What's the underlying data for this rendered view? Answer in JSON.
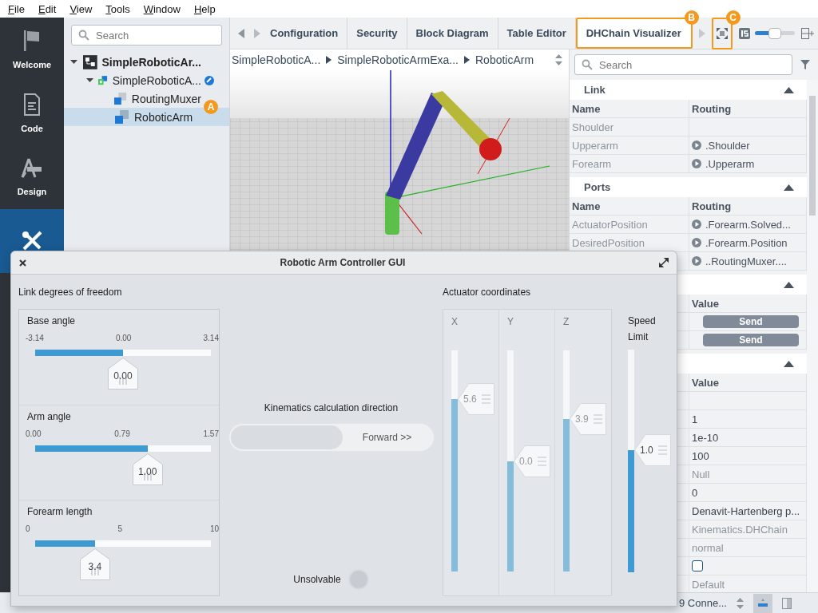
{
  "menu": [
    "File",
    "Edit",
    "View",
    "Tools",
    "Window",
    "Help"
  ],
  "activity_bar": [
    {
      "label": "Welcome",
      "selected": false
    },
    {
      "label": "Code",
      "selected": false
    },
    {
      "label": "Design",
      "selected": false
    },
    {
      "selected": true
    }
  ],
  "tree": {
    "search": {
      "placeholder": "Search"
    },
    "callout": "A",
    "items": [
      {
        "label": "SimpleRoboticAr...",
        "kind": "project",
        "expanded": true,
        "selected": false,
        "children": [
          {
            "label": "SimpleRoboticA...",
            "kind": "module",
            "expanded": true,
            "selected": false,
            "children": [
              {
                "label": "RoutingMuxer",
                "kind": "block",
                "selected": false
              },
              {
                "label": "RoboticArm",
                "kind": "block",
                "selected": true
              }
            ]
          }
        ]
      }
    ]
  },
  "tabs": [
    {
      "label": "Configuration",
      "selected": false
    },
    {
      "label": "Security",
      "selected": false
    },
    {
      "label": "Block Diagram",
      "selected": false
    },
    {
      "label": "Table Editor",
      "selected": false
    },
    {
      "label": "DHChain Visualizer",
      "selected": true,
      "callout": "B"
    }
  ],
  "toolbar": {
    "fit_button": {
      "callout": "C"
    },
    "zoom_slider": {
      "level": 0.5
    }
  },
  "breadcrumb": [
    "SimpleRoboticA...",
    "SimpleRoboticArmExa...",
    "RoboticArm"
  ],
  "properties": {
    "search": {
      "placeholder": "Search"
    },
    "sections": [
      {
        "title": "Link",
        "expanded": true,
        "columns": [
          "Name",
          "Routing"
        ],
        "rows": [
          {
            "name": "Shoulder",
            "kind": "text"
          },
          {
            "name": "Upperarm",
            "kind": "link",
            "value": ".Shoulder"
          },
          {
            "name": "Forearm",
            "kind": "link",
            "value": ".Upperarm"
          }
        ]
      },
      {
        "title": "Ports",
        "expanded": true,
        "columns": [
          "Name",
          "Routing"
        ],
        "rows": [
          {
            "name": "ActuatorPosition",
            "kind": "link",
            "value": ".Forearm.Solved..."
          },
          {
            "name": "DesiredPosition",
            "kind": "link",
            "value": ".Forearm.Position"
          },
          {
            "kind": "link",
            "value": "..RoutingMuxer...."
          }
        ]
      },
      {
        "expanded": true,
        "columns": [
          "Value"
        ],
        "rows": [
          {
            "kind": "button",
            "value": "Send"
          },
          {
            "kind": "button",
            "value": "Send"
          }
        ]
      },
      {
        "expanded": true,
        "columns": [
          "Value"
        ],
        "rows": [
          {
            "kind": "text"
          },
          {
            "kind": "text",
            "value": "1",
            "dimmed": false
          },
          {
            "kind": "text",
            "value": "1e-10",
            "dimmed": false
          },
          {
            "kind": "text",
            "value": "100",
            "dimmed": false
          },
          {
            "kind": "text",
            "value": "Null",
            "dimmed": true
          },
          {
            "kind": "text",
            "value": "0",
            "dimmed": false
          },
          {
            "kind": "text",
            "value": "Denavit-Hartenberg p...",
            "dimmed": false
          },
          {
            "kind": "text",
            "value": "Kinematics.DHChain",
            "dimmed": true
          },
          {
            "kind": "text",
            "value": "normal",
            "dimmed": true
          },
          {
            "kind": "checkbox",
            "checked": false
          },
          {
            "kind": "text",
            "value": "Default",
            "dimmed": true
          }
        ]
      }
    ]
  },
  "status_bar": {
    "connection": "9 Conne..."
  },
  "dialog": {
    "title": "Robotic Arm Controller GUI",
    "links": {
      "title": "Link degrees of freedom",
      "sliders": [
        {
          "label": "Base angle",
          "ticks": [
            "-3.14",
            "0.00",
            "3.14"
          ],
          "value": "0.00",
          "level": 0.5
        },
        {
          "label": "Arm angle",
          "ticks": [
            "0.00",
            "0.79",
            "1.57"
          ],
          "value": "1.00",
          "level": 0.64
        },
        {
          "label": "Forearm length",
          "ticks": [
            "0",
            "5",
            "10"
          ],
          "value": "3.4",
          "level": 0.34
        }
      ]
    },
    "direction": {
      "title": "Kinematics calculation direction",
      "label": "Forward >>",
      "on": false
    },
    "unsolvable": {
      "label": "Unsolvable",
      "on": false
    },
    "actuator": {
      "title": "Actuator coordinates",
      "axes": [
        {
          "label": "X",
          "value": "5.6",
          "level": 0.78,
          "disabled": true
        },
        {
          "label": "Y",
          "value": "0.0",
          "level": 0.5,
          "disabled": true
        },
        {
          "label": "Z",
          "value": "3.9",
          "level": 0.69,
          "disabled": true
        }
      ],
      "speed": {
        "label": "Speed Limit",
        "value": "1.0",
        "level": 0.55,
        "disabled": false
      }
    }
  }
}
